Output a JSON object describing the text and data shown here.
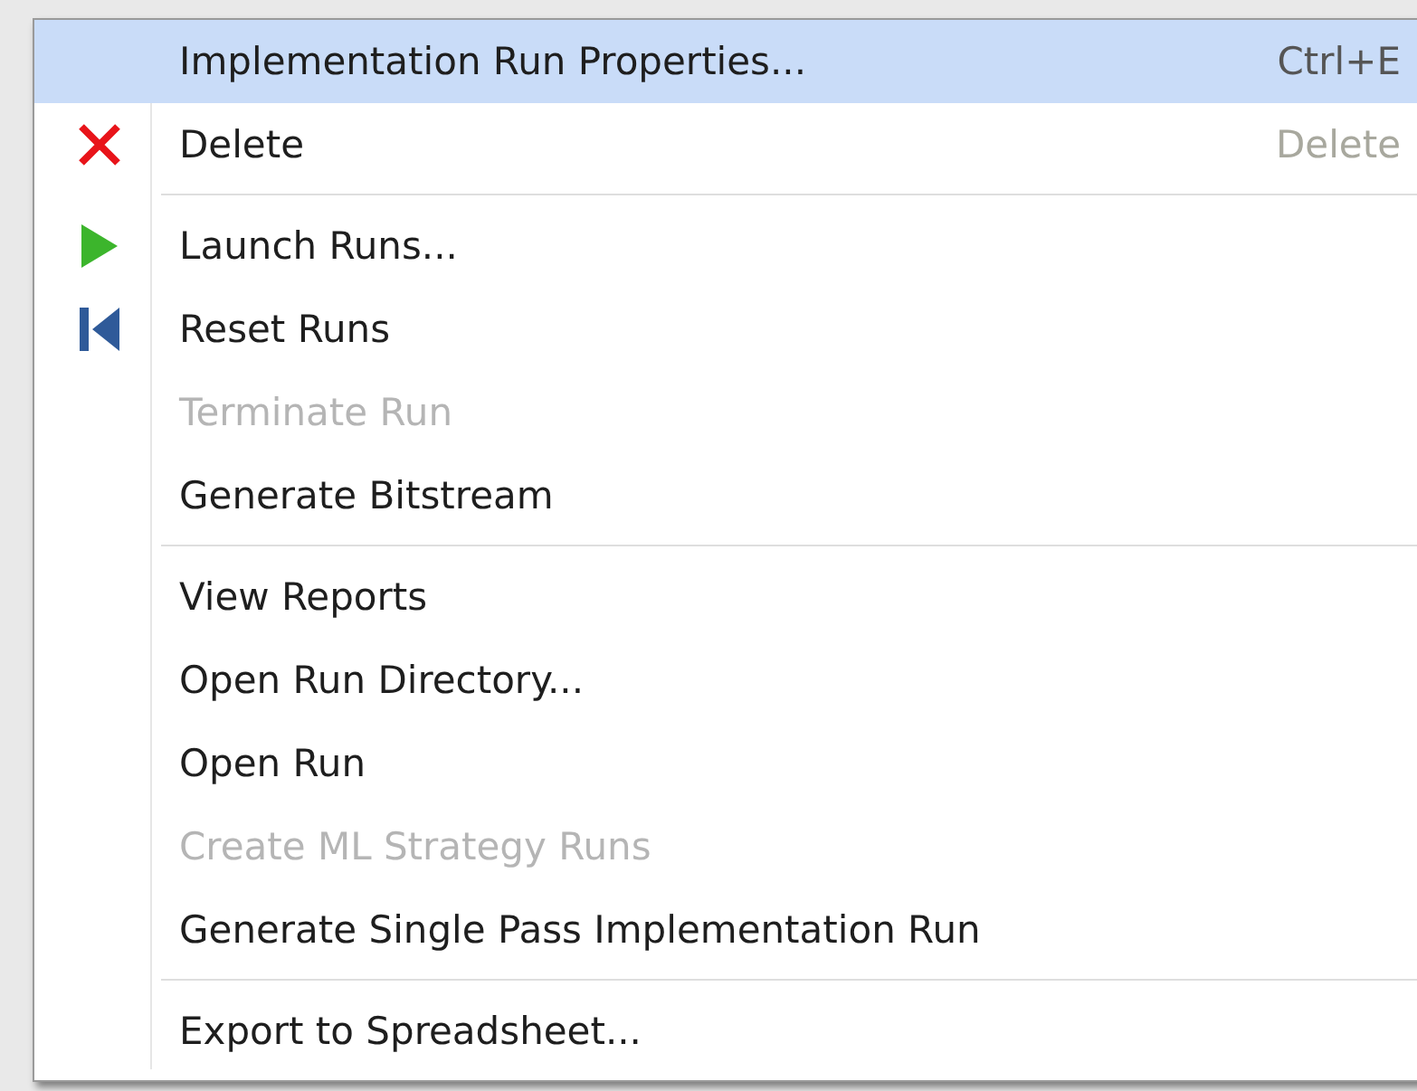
{
  "context_menu": {
    "items": [
      {
        "kind": "plain",
        "label": "Implementation Run Properties...",
        "shortcut": "Ctrl+E",
        "selected": true,
        "disabled": false
      },
      {
        "kind": "delete",
        "label": "Delete",
        "shortcut": "Delete",
        "selected": false,
        "disabled": false
      },
      {
        "kind": "separator"
      },
      {
        "kind": "launch",
        "label": "Launch Runs...",
        "selected": false,
        "disabled": false
      },
      {
        "kind": "reset",
        "label": "Reset Runs",
        "selected": false,
        "disabled": false
      },
      {
        "kind": "plain",
        "label": "Terminate Run",
        "selected": false,
        "disabled": true
      },
      {
        "kind": "plain",
        "label": "Generate Bitstream",
        "selected": false,
        "disabled": false
      },
      {
        "kind": "separator"
      },
      {
        "kind": "plain",
        "label": "View Reports",
        "selected": false,
        "disabled": false
      },
      {
        "kind": "plain",
        "label": "Open Run Directory...",
        "selected": false,
        "disabled": false
      },
      {
        "kind": "plain",
        "label": "Open Run",
        "selected": false,
        "disabled": false
      },
      {
        "kind": "plain",
        "label": "Create ML Strategy Runs",
        "selected": false,
        "disabled": true
      },
      {
        "kind": "plain",
        "label": "Generate Single Pass Implementation Run",
        "selected": false,
        "disabled": false
      },
      {
        "kind": "separator"
      },
      {
        "kind": "plain",
        "label": "Export to Spreadsheet...",
        "selected": false,
        "disabled": false
      }
    ]
  }
}
